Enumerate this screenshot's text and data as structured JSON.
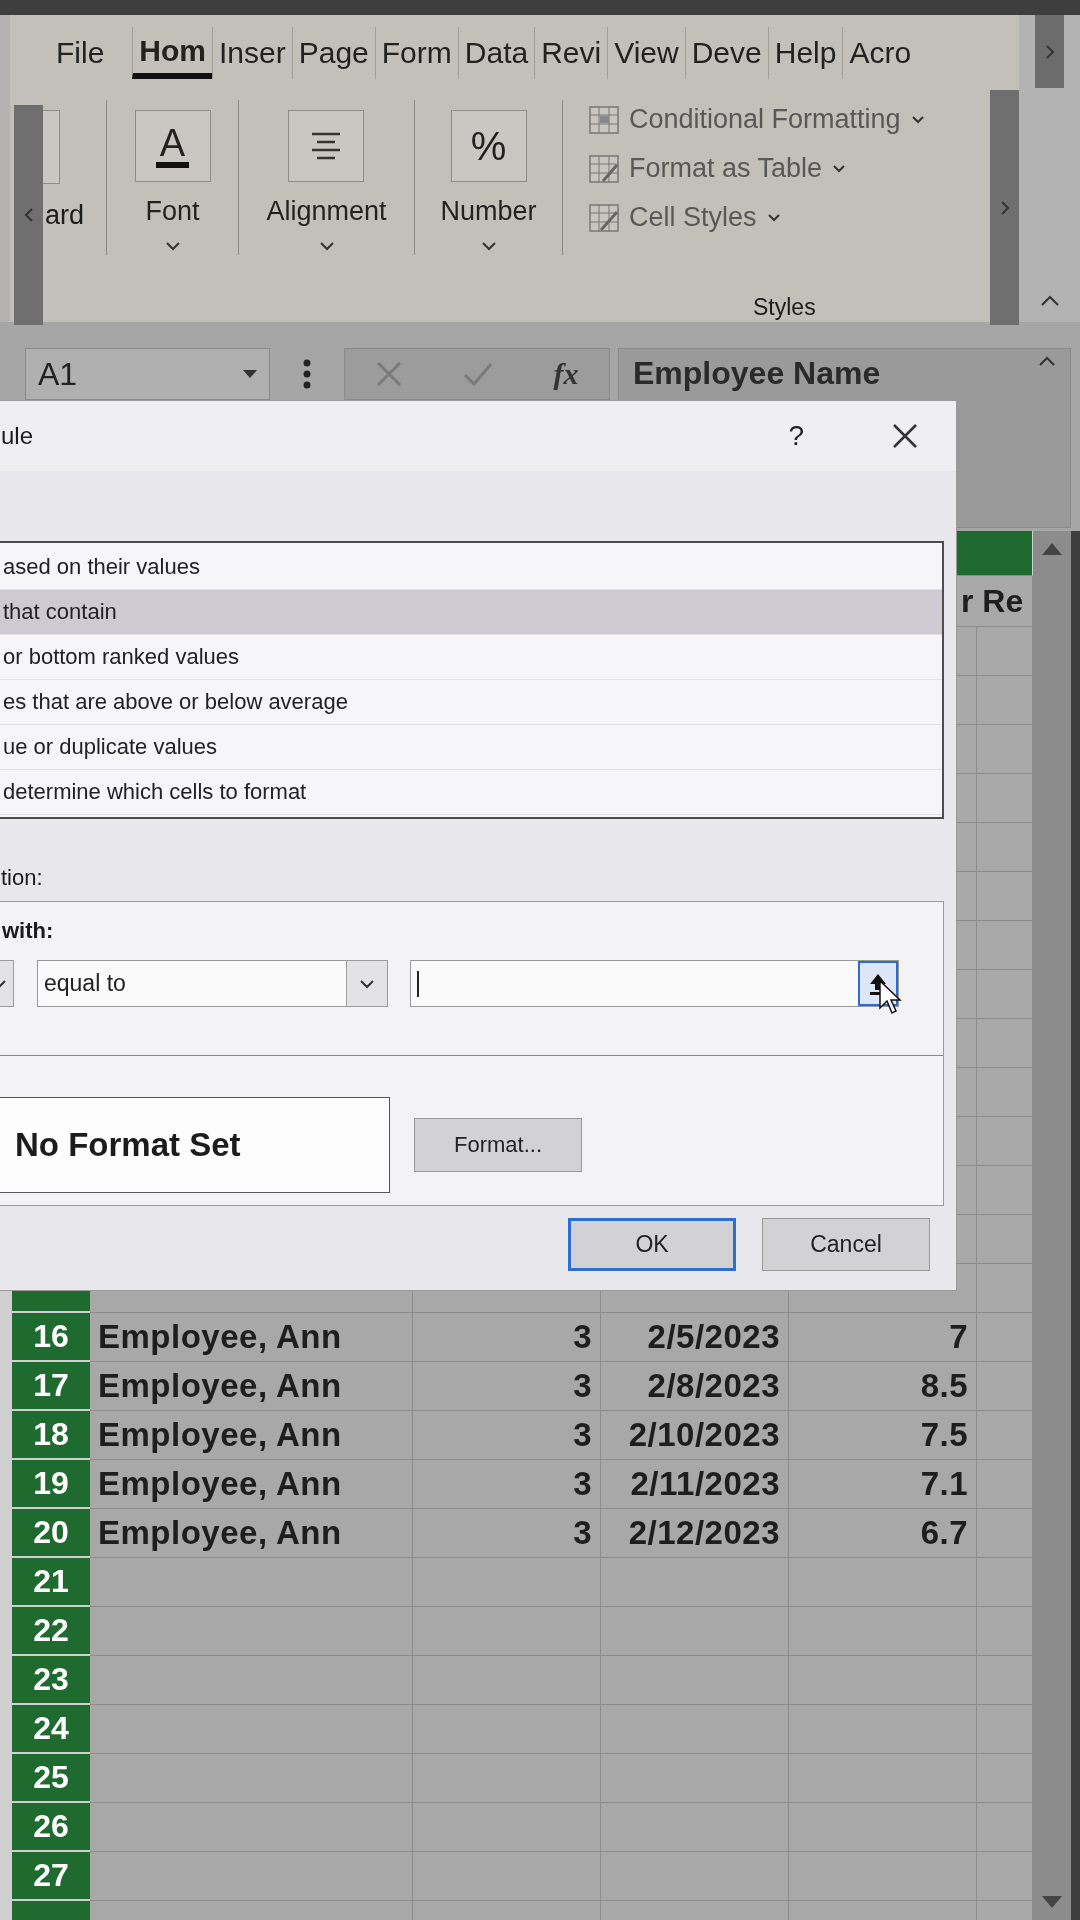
{
  "ribbon": {
    "tabs": [
      {
        "label": "File",
        "selected": false
      },
      {
        "label": "Hom",
        "selected": true
      },
      {
        "label": "Inser",
        "selected": false
      },
      {
        "label": "Page",
        "selected": false
      },
      {
        "label": "Form",
        "selected": false
      },
      {
        "label": "Data",
        "selected": false
      },
      {
        "label": "Revi",
        "selected": false
      },
      {
        "label": "View",
        "selected": false
      },
      {
        "label": "Deve",
        "selected": false
      },
      {
        "label": "Help",
        "selected": false
      },
      {
        "label": "Acro",
        "selected": false
      }
    ],
    "groups": [
      {
        "kind": "clipped",
        "label": "ard"
      },
      {
        "kind": "font",
        "label": "Font",
        "icon_text": "A"
      },
      {
        "kind": "alignment",
        "label": "Alignment"
      },
      {
        "kind": "number",
        "label": "Number",
        "icon_text": "%"
      }
    ],
    "styles": {
      "label": "Styles",
      "items": [
        {
          "kind": "conditional",
          "label": "Conditional Formatting"
        },
        {
          "kind": "table",
          "label": "Format as Table"
        },
        {
          "kind": "cell",
          "label": "Cell Styles"
        }
      ]
    }
  },
  "formula_bar": {
    "name_box": "A1",
    "function_label": "fx",
    "content": "Employee Name"
  },
  "dialog": {
    "title": "ule",
    "help": "?",
    "rule_types": [
      {
        "label": "ased on their values",
        "selected": false
      },
      {
        "label": "that contain",
        "selected": true
      },
      {
        "label": "or bottom ranked values",
        "selected": false
      },
      {
        "label": "es that are above or below average",
        "selected": false
      },
      {
        "label": "ue or duplicate values",
        "selected": false
      },
      {
        "label": "determine which cells to format",
        "selected": false
      }
    ],
    "description_label": "tion:",
    "format_label": "with:",
    "operator": "equal to",
    "preview": "No Format Set",
    "format_button": "Format...",
    "buttons": [
      {
        "label": "OK",
        "default": true
      },
      {
        "label": "Cancel",
        "default": false
      }
    ]
  },
  "sheet": {
    "header_fragment": "r Re",
    "rows": [
      {
        "number": "16",
        "cells": [
          "Employee, Ann",
          "3",
          "2/5/2023",
          "7"
        ]
      },
      {
        "number": "17",
        "cells": [
          "Employee, Ann",
          "3",
          "2/8/2023",
          "8.5"
        ]
      },
      {
        "number": "18",
        "cells": [
          "Employee, Ann",
          "3",
          "2/10/2023",
          "7.5"
        ]
      },
      {
        "number": "19",
        "cells": [
          "Employee, Ann",
          "3",
          "2/11/2023",
          "7.1"
        ]
      },
      {
        "number": "20",
        "cells": [
          "Employee, Ann",
          "3",
          "2/12/2023",
          "6.7"
        ]
      },
      {
        "number": "21"
      },
      {
        "number": "22"
      },
      {
        "number": "23"
      },
      {
        "number": "24"
      },
      {
        "number": "25"
      },
      {
        "number": "26"
      },
      {
        "number": "27"
      }
    ]
  }
}
